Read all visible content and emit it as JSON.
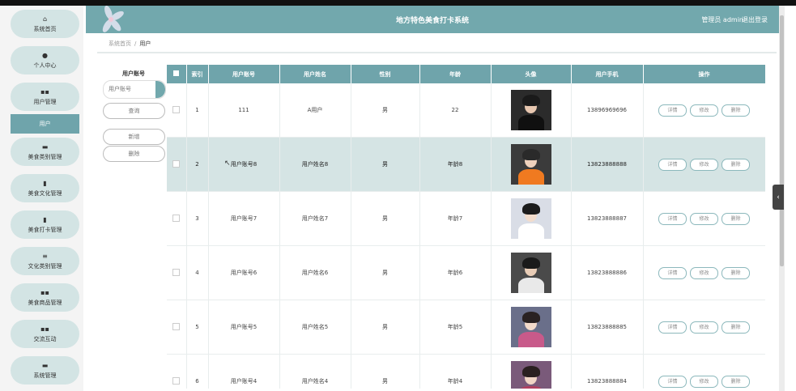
{
  "app": {
    "title": "地方特色美食打卡系统",
    "user": "管理员 admin",
    "logout": "退出登录"
  },
  "sidebar": {
    "items": [
      {
        "label": "系统首页",
        "icon": "home-icon",
        "glyph": "⌂"
      },
      {
        "label": "个人中心",
        "icon": "person-icon",
        "glyph": "●"
      },
      {
        "label": "用户管理",
        "icon": "grid-icon",
        "glyph": "▪▪"
      },
      {
        "label": "美食类别管理",
        "icon": "briefcase-icon",
        "glyph": "▬"
      },
      {
        "label": "美食文化管理",
        "icon": "bag-icon",
        "glyph": "▮"
      },
      {
        "label": "美食打卡管理",
        "icon": "calendar-icon",
        "glyph": "▮"
      },
      {
        "label": "文化类别管理",
        "icon": "list-icon",
        "glyph": "≡"
      },
      {
        "label": "美食商品管理",
        "icon": "grid-icon",
        "glyph": "▪▪"
      },
      {
        "label": "交流互动",
        "icon": "grid-icon",
        "glyph": "▪▪"
      },
      {
        "label": "系统管理",
        "icon": "monitor-icon",
        "glyph": "▬"
      }
    ],
    "active_sub": "用户"
  },
  "breadcrumb": {
    "home": "系统首页",
    "sep": "/",
    "current": "用户"
  },
  "search": {
    "label": "用户账号",
    "placeholder": "用户账号",
    "query_btn": "查询",
    "add_btn": "新增",
    "delete_btn": "删除"
  },
  "table": {
    "headers": [
      "索引",
      "用户账号",
      "用户姓名",
      "性别",
      "年龄",
      "头像",
      "用户手机",
      "操作"
    ],
    "actions": {
      "detail": "详情",
      "edit": "修改",
      "delete": "删除"
    },
    "rows": [
      {
        "index": "1",
        "account": "111",
        "name": "A用户",
        "gender": "男",
        "age": "22",
        "phone": "13896969696",
        "avatar_bg": "#2b2b2b",
        "hair": "#1a1a1a",
        "face": "#e7c7b0",
        "body": "#101010"
      },
      {
        "index": "2",
        "account": "用户账号8",
        "name": "用户姓名8",
        "gender": "男",
        "age": "年龄8",
        "phone": "13823888888",
        "avatar_bg": "#3b3b3b",
        "hair": "#2a2a2a",
        "face": "#efd2bd",
        "body": "#f07a20"
      },
      {
        "index": "3",
        "account": "用户账号7",
        "name": "用户姓名7",
        "gender": "男",
        "age": "年龄7",
        "phone": "13823888887",
        "avatar_bg": "#d9dde6",
        "hair": "#1c1c1c",
        "face": "#f2dccc",
        "body": "#ffffff"
      },
      {
        "index": "4",
        "account": "用户账号6",
        "name": "用户姓名6",
        "gender": "男",
        "age": "年龄6",
        "phone": "13823888886",
        "avatar_bg": "#4a4a4a",
        "hair": "#1a1a1a",
        "face": "#e9cdb7",
        "body": "#e9e9e9"
      },
      {
        "index": "5",
        "account": "用户账号5",
        "name": "用户姓名5",
        "gender": "男",
        "age": "年龄5",
        "phone": "13823888885",
        "avatar_bg": "#6a6f8a",
        "hair": "#2a2222",
        "face": "#f3dacb",
        "body": "#c85a8a"
      },
      {
        "index": "6",
        "account": "用户账号4",
        "name": "用户姓名4",
        "gender": "男",
        "age": "年龄4",
        "phone": "13823888884",
        "avatar_bg": "#7a5a7a",
        "hair": "#2a2020",
        "face": "#f0d5c5",
        "body": "#b04060"
      }
    ],
    "highlighted_row": 1
  },
  "colors": {
    "accent": "#72a8ad",
    "header_bg": "#6fa4ab",
    "highlight_row": "#d5e4e4"
  }
}
